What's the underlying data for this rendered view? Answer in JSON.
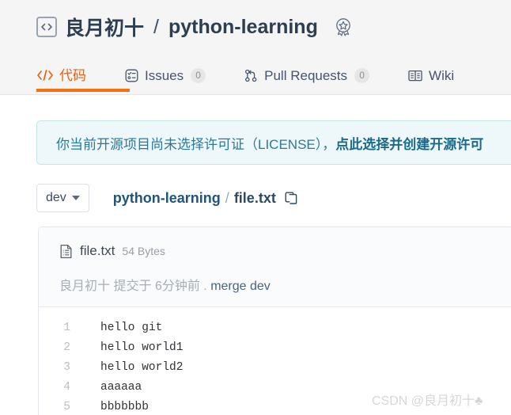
{
  "header": {
    "code_icon": "code-brackets-icon",
    "owner": "良月初十",
    "separator": "/",
    "repo": "python-learning",
    "badge_icon": "award-star-icon"
  },
  "tabs": [
    {
      "label": "代码",
      "icon": "code-slash-icon",
      "count": null,
      "active": true
    },
    {
      "label": "Issues",
      "icon": "issue-list-icon",
      "count": "0",
      "active": false
    },
    {
      "label": "Pull Requests",
      "icon": "git-pull-request-icon",
      "count": "0",
      "active": false
    },
    {
      "label": "Wiki",
      "icon": "book-icon",
      "count": null,
      "active": false
    }
  ],
  "license_banner": {
    "text": "你当前开源项目尚未选择许可证（LICENSE），",
    "link": "点此选择并创建开源许可",
    "bg_color": "#eef7fa",
    "border_color": "#c7e3ea",
    "text_color": "#2a7a99"
  },
  "branch": {
    "name": "dev",
    "caret_icon": "chevron-down-icon"
  },
  "breadcrumb": {
    "repo": "python-learning",
    "separator": "/",
    "file": "file.txt",
    "copy_icon": "copy-icon"
  },
  "file_card": {
    "doc_icon": "file-text-icon",
    "name": "file.txt",
    "size": "54 Bytes",
    "commit": {
      "author": "良月初十",
      "action": "提交于",
      "time": "6分钟前",
      "dot": ".",
      "message": "merge dev"
    }
  },
  "code": {
    "lines": [
      {
        "n": "1",
        "text": "hello git"
      },
      {
        "n": "2",
        "text": "hello world1"
      },
      {
        "n": "3",
        "text": "hello world2"
      },
      {
        "n": "4",
        "text": "aaaaaa"
      },
      {
        "n": "5",
        "text": "bbbbbbb"
      }
    ]
  },
  "watermark": {
    "text": "CSDN @良月初十♣"
  },
  "accent": {
    "active_tab": "#f1600d",
    "underline": "#f4720c",
    "link_blue": "#20557c"
  }
}
